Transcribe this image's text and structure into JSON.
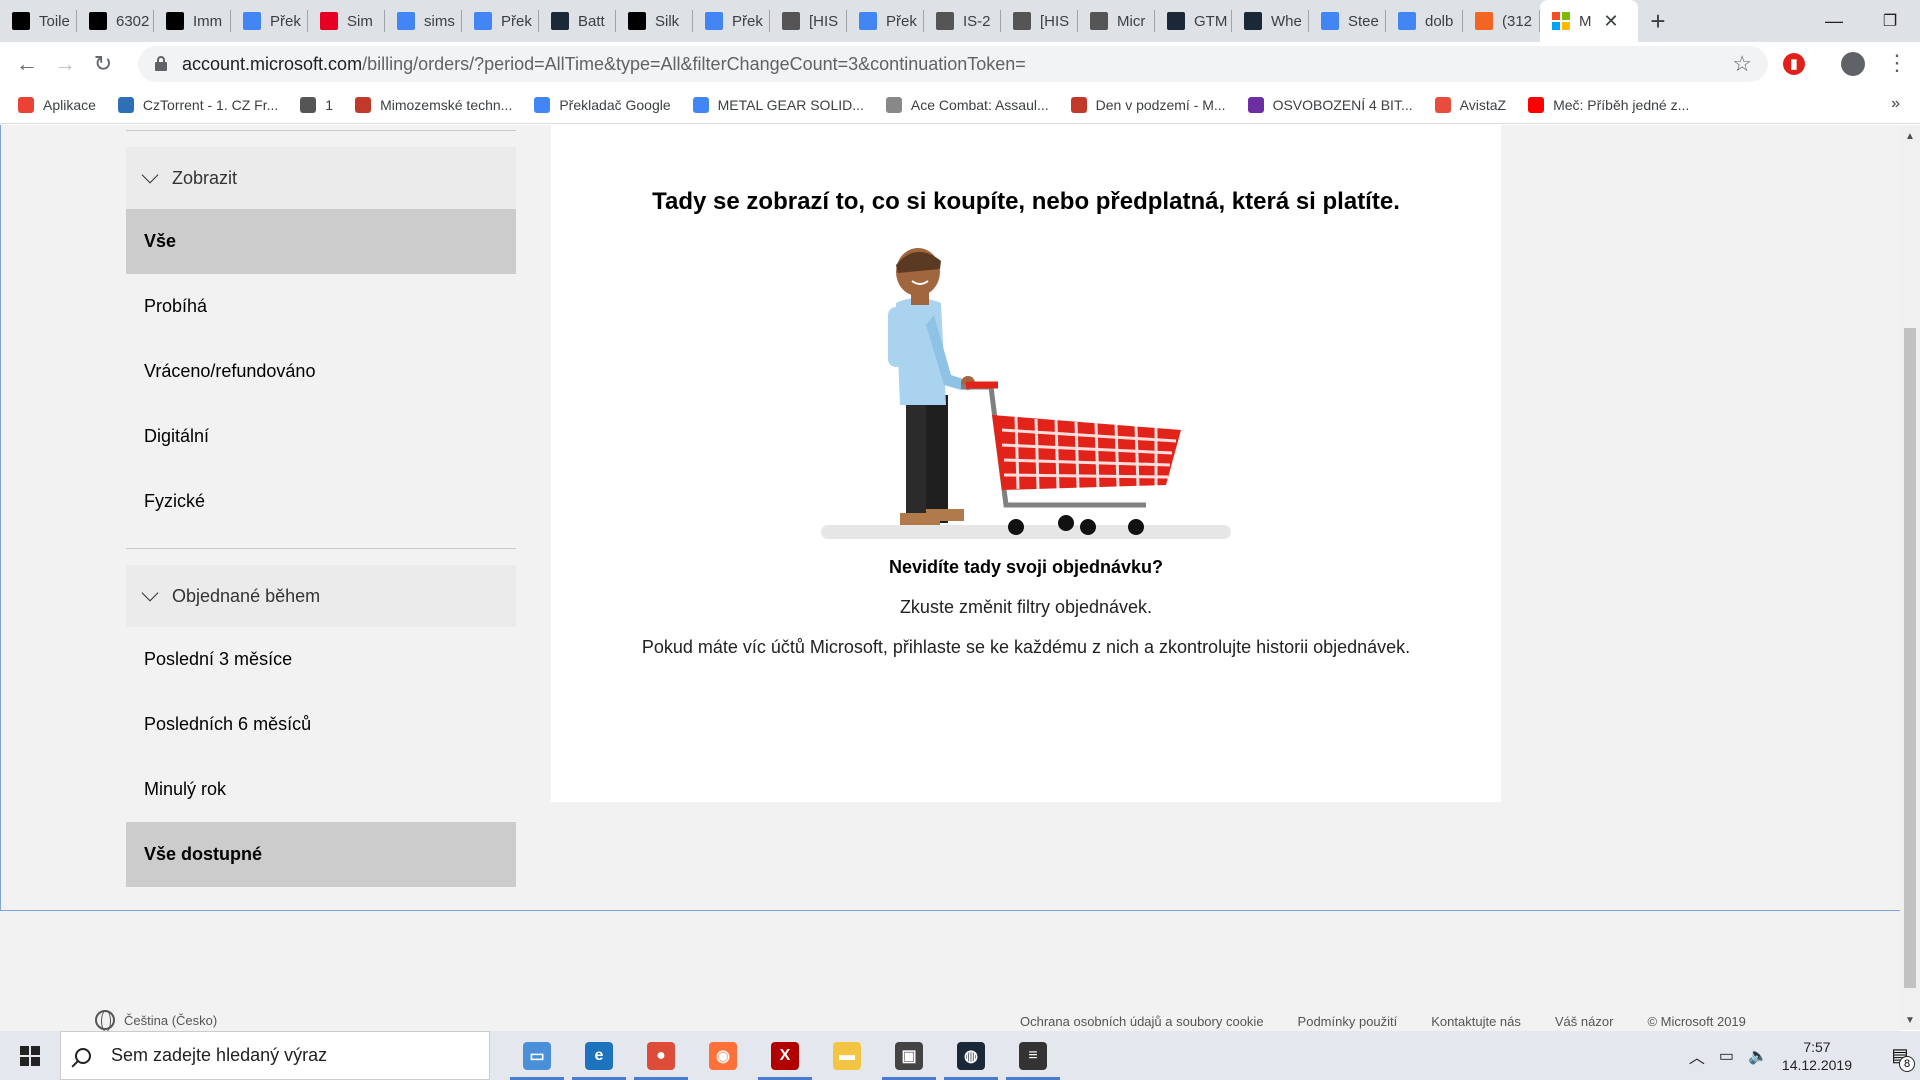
{
  "browser": {
    "tabs": [
      {
        "label": "Toile",
        "color": "#000000",
        "icon": "l-letter-icon"
      },
      {
        "label": "6302",
        "color": "#000000",
        "icon": "l-letter-icon"
      },
      {
        "label": "Imm",
        "color": "#000000",
        "icon": "l-letter-icon"
      },
      {
        "label": "Přek",
        "color": "#4285f4",
        "icon": "translate-icon"
      },
      {
        "label": "Sim",
        "color": "#e60023",
        "icon": "pinterest-icon"
      },
      {
        "label": "sims",
        "color": "#4285f4",
        "icon": "google-icon"
      },
      {
        "label": "Přek",
        "color": "#4285f4",
        "icon": "translate-icon"
      },
      {
        "label": "Batt",
        "color": "#1b2838",
        "icon": "steam-icon"
      },
      {
        "label": "Silk",
        "color": "#000000",
        "icon": "l-letter-icon"
      },
      {
        "label": "Přek",
        "color": "#4285f4",
        "icon": "translate-icon"
      },
      {
        "label": "[HIS",
        "color": "#555555",
        "icon": "plane-icon"
      },
      {
        "label": "Přek",
        "color": "#4285f4",
        "icon": "translate-icon"
      },
      {
        "label": "IS-2",
        "color": "#555555",
        "icon": "globe-icon"
      },
      {
        "label": "[HIS",
        "color": "#555555",
        "icon": "plane-icon"
      },
      {
        "label": "Micr",
        "color": "#555555",
        "icon": "globe-icon"
      },
      {
        "label": "GTM",
        "color": "#1b2838",
        "icon": "steam-icon"
      },
      {
        "label": "Whe",
        "color": "#1b2838",
        "icon": "steam-icon"
      },
      {
        "label": "Stee",
        "color": "#4285f4",
        "icon": "google-icon"
      },
      {
        "label": "dolb",
        "color": "#4285f4",
        "icon": "google-icon"
      },
      {
        "label": "(312",
        "color": "#f26522",
        "icon": "flame-icon"
      }
    ],
    "active_tab": {
      "label": "M",
      "icon": "microsoft-icon"
    },
    "new_tab": "+",
    "minimize": "—",
    "maximize": "❐",
    "close": "✕",
    "url_host": "account.microsoft.com",
    "url_path": "/billing/orders/?period=AllTime&type=All&filterChangeCount=3&continuationToken=",
    "bookmarks": [
      {
        "label": "Aplikace",
        "color": "#ea4335"
      },
      {
        "label": "CzTorrent - 1. CZ Fr...",
        "color": "#2f6fb5"
      },
      {
        "label": "1",
        "color": "#555555"
      },
      {
        "label": "Mimozemské techn...",
        "color": "#c0392b"
      },
      {
        "label": "Překladač Google",
        "color": "#4285f4"
      },
      {
        "label": "METAL GEAR SOLID...",
        "color": "#4285f4"
      },
      {
        "label": "Ace Combat: Assaul...",
        "color": "#888888"
      },
      {
        "label": "Den v podzemí - M...",
        "color": "#c0392b"
      },
      {
        "label": "OSVOBOZENÍ 4 BIT...",
        "color": "#6b2fa1"
      },
      {
        "label": "AvistaZ",
        "color": "#e74c3c"
      },
      {
        "label": "Meč: Příběh jedné z...",
        "color": "#ff0000"
      }
    ],
    "bookmarks_more": "»"
  },
  "sidebar": {
    "filter_header": "Zobrazit",
    "filter_items": [
      "Vše",
      "Probíhá",
      "Vráceno/refundováno",
      "Digitální",
      "Fyzické"
    ],
    "selected_filter": "Vše",
    "period_header": "Objednané během",
    "period_items": [
      "Poslední 3 měsíce",
      "Posledních 6 měsíců",
      "Minulý rok",
      "Vše dostupné"
    ],
    "selected_period": "Vše dostupné"
  },
  "main": {
    "title": "Tady se zobrazí to, co si koupíte, nebo předplatná, která si platíte.",
    "help_title": "Nevidíte tady svoji objednávku?",
    "help_line1": "Zkuste změnit filtry objednávek.",
    "help_line2": "Pokud máte víc účtů Microsoft, přihlaste se ke každému z nich a zkontrolujte historii objednávek."
  },
  "footer": {
    "language": "Čeština (Česko)",
    "links": [
      "Ochrana osobních údajů a soubory cookie",
      "Podmínky použití",
      "Kontaktujte nás",
      "Váš názor",
      "© Microsoft 2019"
    ]
  },
  "taskbar": {
    "search_placeholder": "Sem zadejte hledaný výraz",
    "apps": [
      {
        "name": "laptop",
        "color": "#4a90d9",
        "glyph": "▭"
      },
      {
        "name": "edge",
        "color": "#1e73be",
        "glyph": "e"
      },
      {
        "name": "chrome",
        "color": "#dd4b39",
        "glyph": "●"
      },
      {
        "name": "firefox",
        "color": "#ff7139",
        "glyph": "◉"
      },
      {
        "name": "xcom",
        "color": "#b00000",
        "glyph": "X"
      },
      {
        "name": "file-explorer",
        "color": "#f4c542",
        "glyph": "▬"
      },
      {
        "name": "monitor-app",
        "color": "#444444",
        "glyph": "▣"
      },
      {
        "name": "steam",
        "color": "#1b2838",
        "glyph": "◍"
      },
      {
        "name": "disk-app",
        "color": "#333333",
        "glyph": "≡"
      }
    ],
    "time": "7:57",
    "date": "14.12.2019",
    "notifications": "8"
  }
}
